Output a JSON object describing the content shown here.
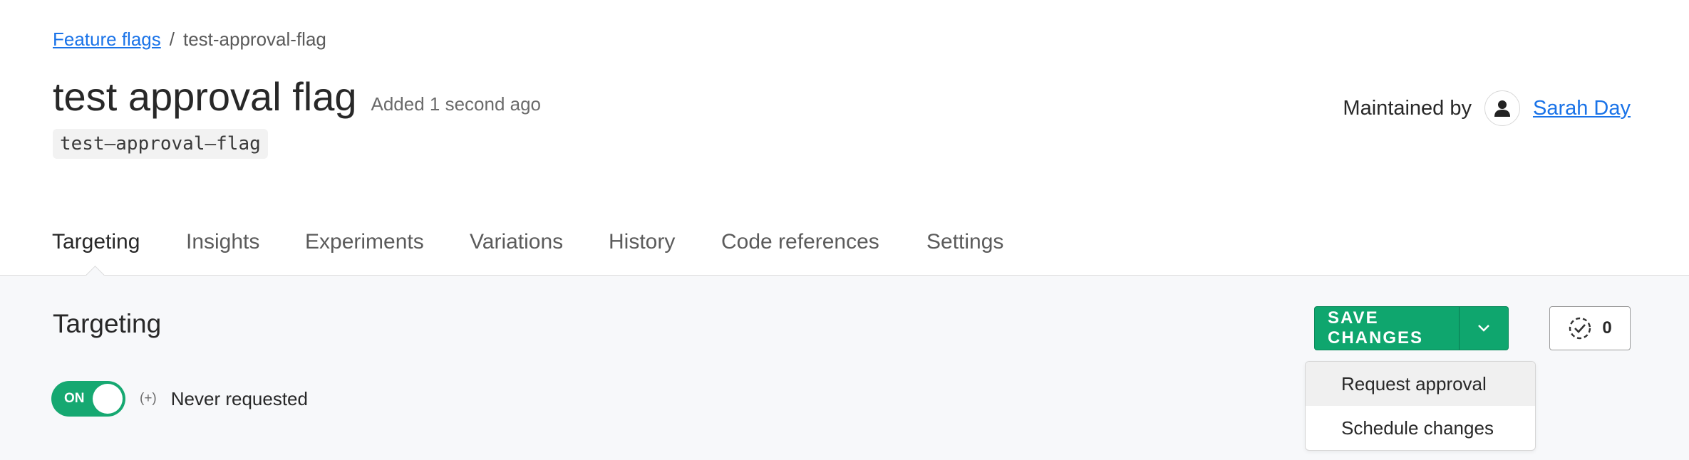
{
  "breadcrumb": {
    "parent": "Feature flags",
    "separator": "/",
    "current": "test-approval-flag"
  },
  "flag": {
    "name": "test approval flag",
    "added": "Added 1 second ago",
    "key": "test–approval–flag"
  },
  "maintainer": {
    "label": "Maintained by",
    "name": "Sarah Day",
    "avatar_icon": "person-icon"
  },
  "tabs": [
    {
      "label": "Targeting",
      "active": true
    },
    {
      "label": "Insights"
    },
    {
      "label": "Experiments"
    },
    {
      "label": "Variations"
    },
    {
      "label": "History"
    },
    {
      "label": "Code references"
    },
    {
      "label": "Settings"
    }
  ],
  "section": {
    "title": "Targeting"
  },
  "toggle": {
    "state_label": "ON",
    "plus": "(+)",
    "status_text": "Never requested",
    "on_color": "#16a871"
  },
  "actions": {
    "save_label": "SAVE CHANGES",
    "caret_icon": "chevron-down-icon",
    "approvals_icon": "pending-approval-icon",
    "approvals_count": "0",
    "save_color": "#0fa66e"
  },
  "dropdown": {
    "items": [
      {
        "label": "Request approval",
        "highlighted": true
      },
      {
        "label": "Schedule changes"
      }
    ]
  }
}
